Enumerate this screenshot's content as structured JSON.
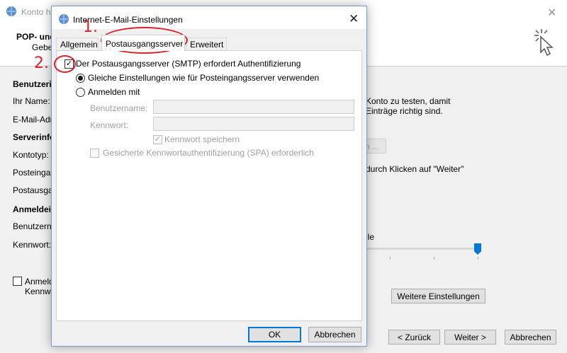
{
  "background_window": {
    "title": "Konto h",
    "header_title": "POP- und",
    "header_subtitle": "Geben",
    "labels": {
      "benutzerinfo": "Benutzerin",
      "ihr_name": "Ihr Name:",
      "email": "E-Mail-Adr",
      "serverinfo": "Serverinfo",
      "kontotyp": "Kontotyp:",
      "posteingang": "Posteingan",
      "postausgang": "Postausga",
      "anmeldeinfo": "Anmeldein",
      "benutzername": "Benutzern",
      "kennwort": "Kennwort:",
      "anmelden_cb_line1": "Anmelde",
      "anmelden_cb_line2": "Kennw"
    },
    "right_text_line1": "Konto zu testen, damit",
    "right_text_line2": "Einträge richtig sind.",
    "test_button_partial": "n ...",
    "weiter_hint": "durch Klicken auf \"Weiter\"",
    "slider_label_partial": "lle",
    "slider_value": 1.0,
    "more_settings_button": "Weitere Einstellungen",
    "back_button": "< Zurück",
    "next_button": "Weiter >",
    "cancel_button": "Abbrechen"
  },
  "dialog": {
    "title": "Internet-E-Mail-Einstellungen",
    "tabs": [
      "Allgemein",
      "Postausgangsserver",
      "Erweitert"
    ],
    "active_tab": "Postausgangsserver",
    "smtp_auth_label": "Der Postausgangsserver (SMTP) erfordert Authentifizierung",
    "smtp_auth_checked": true,
    "radio_same": "Gleiche Einstellungen wie für Posteingangsserver verwenden",
    "radio_login": "Anmelden mit",
    "selected_radio": "same",
    "username_label": "Benutzername:",
    "username_value": "",
    "password_label": "Kennwort:",
    "password_value": "",
    "save_password_label": "Kennwort speichern",
    "spa_label": "Gesicherte Kennwortauthentifizierung (SPA) erforderlich",
    "ok_button": "OK",
    "cancel_button": "Abbrechen"
  },
  "annotations": {
    "step1": "1.",
    "step2": "2.",
    "color": "#d9202b"
  },
  "colors": {
    "accent": "#0078d7",
    "dialog_border": "#7a9ad3"
  }
}
